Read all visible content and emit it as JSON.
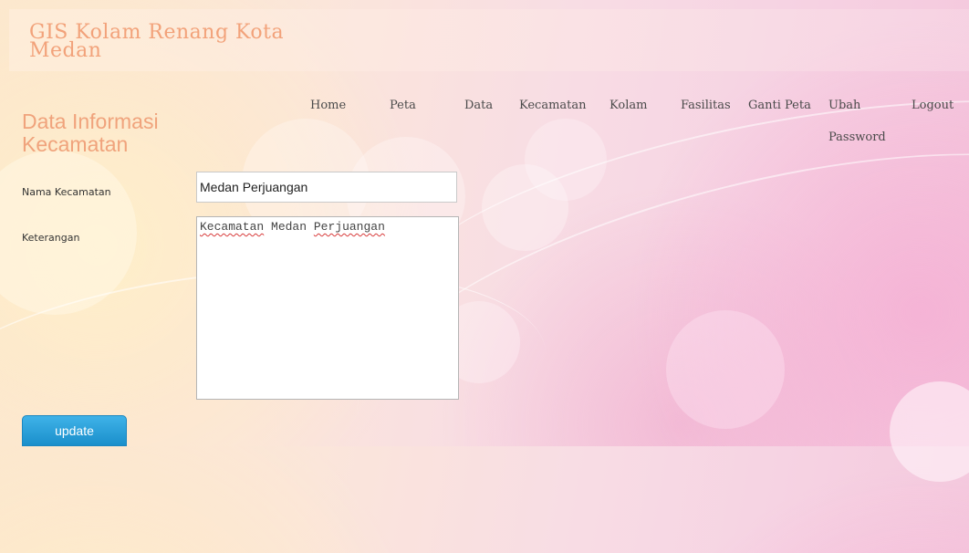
{
  "header": {
    "site_title": "GIS Kolam Renang Kota Medan"
  },
  "nav": {
    "items": [
      "Home",
      "Peta",
      "Data",
      "Kecamatan",
      "Kolam",
      "Fasilitas",
      "Ganti Peta",
      "Ubah Password",
      "Logout"
    ]
  },
  "page": {
    "section_title": "Data Informasi Kecamatan"
  },
  "form": {
    "nama_label": "Nama Kecamatan",
    "nama_value": "Medan Perjuangan",
    "keterangan_label": "Keterangan",
    "keterangan_words": [
      "Kecamatan",
      "Medan",
      "Perjuangan"
    ],
    "submit_label": "update"
  }
}
